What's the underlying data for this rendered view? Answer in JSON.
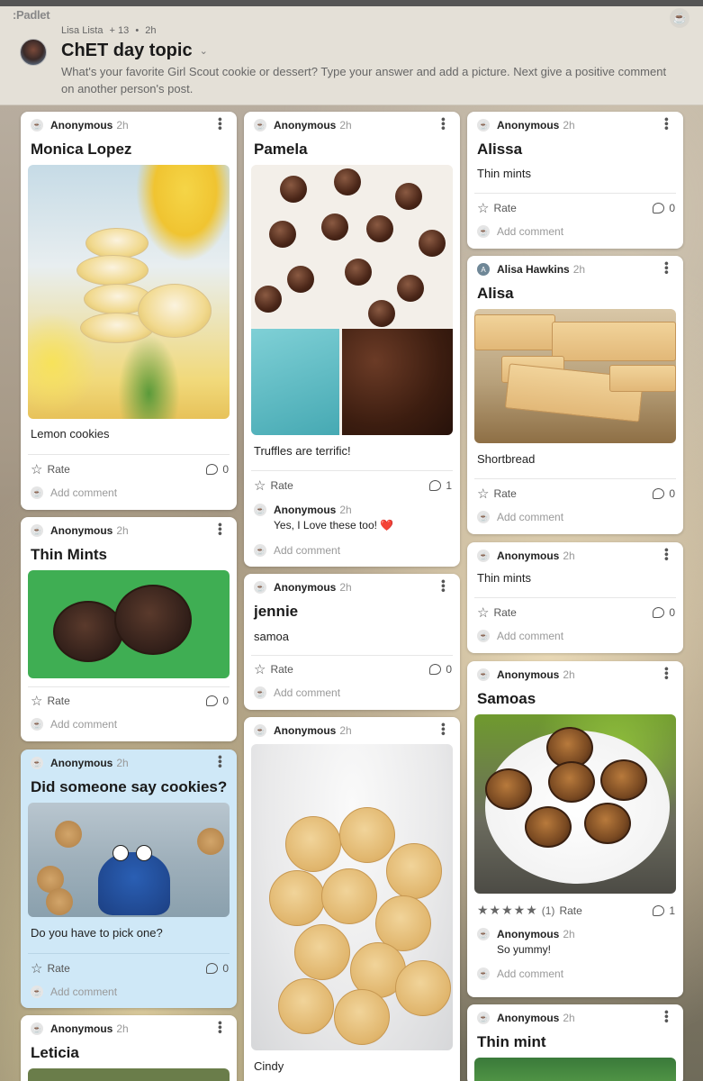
{
  "header": {
    "logo": ":Padlet",
    "author": "Lisa Lista",
    "collaborators": "+ 13",
    "time": "2h",
    "title": "ChET day topic",
    "description": "What's your favorite Girl Scout cookie or dessert? Type your answer and add a picture. Next give a positive comment on another person's post."
  },
  "labels": {
    "rate": "Rate",
    "add_comment": "Add comment"
  },
  "posts": {
    "monica": {
      "author": "Anonymous",
      "time": "2h",
      "title": "Monica Lopez",
      "body": "Lemon cookies",
      "comments": "0"
    },
    "thinmints": {
      "author": "Anonymous",
      "time": "2h",
      "title": "Thin Mints",
      "comments": "0"
    },
    "cookies": {
      "author": "Anonymous",
      "time": "2h",
      "title": "Did someone say cookies?",
      "body": "Do you have to pick one?",
      "comments": "0"
    },
    "leticia": {
      "author": "Anonymous",
      "time": "2h",
      "title": "Leticia"
    },
    "pamela": {
      "author": "Anonymous",
      "time": "2h",
      "title": "Pamela",
      "body": "Truffles are terrific!",
      "comments": "1",
      "reply": {
        "author": "Anonymous",
        "time": "2h",
        "text": "Yes, I Love these too! ",
        "emoji": "❤️"
      }
    },
    "jennie": {
      "author": "Anonymous",
      "time": "2h",
      "title": "jennie",
      "body": "samoa",
      "comments": "0"
    },
    "cindy": {
      "author": "Anonymous",
      "time": "2h",
      "body": "Cindy"
    },
    "alissa": {
      "author": "Anonymous",
      "time": "2h",
      "title": "Alissa",
      "body": "Thin mints",
      "comments": "0"
    },
    "alisa": {
      "author": "Alisa Hawkins",
      "avatar_letter": "A",
      "time": "2h",
      "title": "Alisa",
      "body": "Shortbread",
      "comments": "0"
    },
    "thinmints2": {
      "author": "Anonymous",
      "time": "2h",
      "body": "Thin mints",
      "comments": "0"
    },
    "samoas": {
      "author": "Anonymous",
      "time": "2h",
      "title": "Samoas",
      "rating_stars": "★★★★★",
      "rating_count": "(1)",
      "comments": "1",
      "reply": {
        "author": "Anonymous",
        "time": "2h",
        "text": "So yummy!"
      }
    },
    "thinmint": {
      "author": "Anonymous",
      "time": "2h",
      "title": "Thin mint"
    }
  },
  "colors": {
    "blue_card": "#cfe8f7",
    "heart": "#d92a2a"
  }
}
